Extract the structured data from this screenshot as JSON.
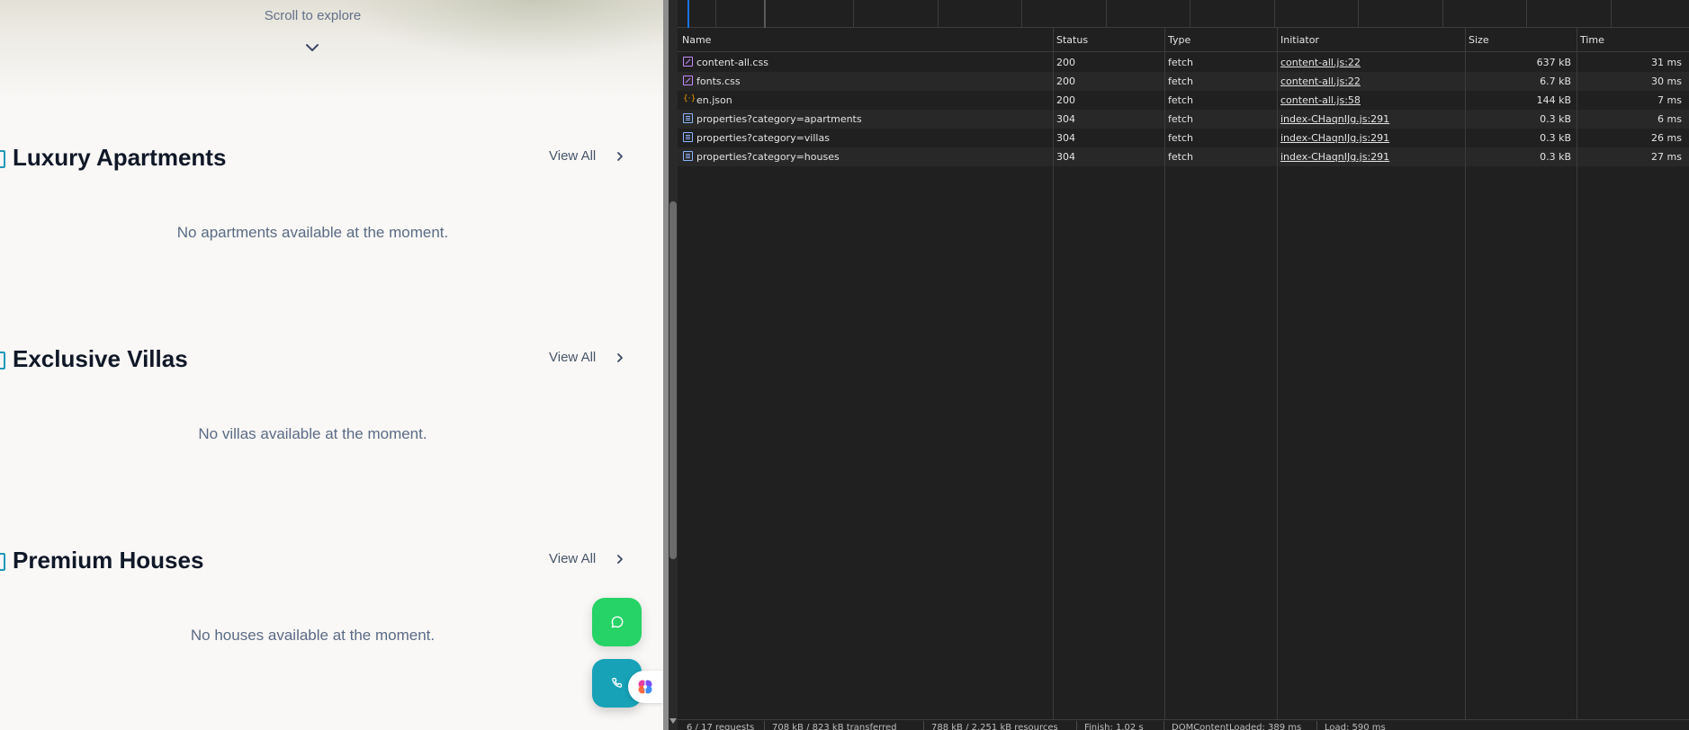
{
  "site": {
    "scroll_hint": "Scroll to explore",
    "sections": [
      {
        "title": "Luxury Apartments",
        "view_all": "View All",
        "empty": "No apartments available at the moment."
      },
      {
        "title": "Exclusive Villas",
        "view_all": "View All",
        "empty": "No villas available at the moment."
      },
      {
        "title": "Premium Houses",
        "view_all": "View All",
        "empty": "No houses available at the moment."
      }
    ],
    "fab_chat_icon": "chat-bubble-icon",
    "fab_phone_icon": "phone-icon",
    "assistant_icon": "brain-icon"
  },
  "devtools": {
    "columns": [
      "Name",
      "Status",
      "Type",
      "Initiator",
      "Size",
      "Time"
    ],
    "rows": [
      {
        "icon": "css",
        "name": "content-all.css",
        "status": "200",
        "type": "fetch",
        "initiator": "content-all.js:22",
        "size": "637 kB",
        "time": "31 ms"
      },
      {
        "icon": "css",
        "name": "fonts.css",
        "status": "200",
        "type": "fetch",
        "initiator": "content-all.js:22",
        "size": "6.7 kB",
        "time": "30 ms"
      },
      {
        "icon": "json",
        "name": "en.json",
        "status": "200",
        "type": "fetch",
        "initiator": "content-all.js:58",
        "size": "144 kB",
        "time": "7 ms"
      },
      {
        "icon": "doc",
        "name": "properties?category=apartments",
        "status": "304",
        "type": "fetch",
        "initiator": "index-CHaqnIJg.js:291",
        "size": "0.3 kB",
        "time": "6 ms"
      },
      {
        "icon": "doc",
        "name": "properties?category=villas",
        "status": "304",
        "type": "fetch",
        "initiator": "index-CHaqnIJg.js:291",
        "size": "0.3 kB",
        "time": "26 ms"
      },
      {
        "icon": "doc",
        "name": "properties?category=houses",
        "status": "304",
        "type": "fetch",
        "initiator": "index-CHaqnIJg.js:291",
        "size": "0.3 kB",
        "time": "27 ms"
      }
    ],
    "status_bar": [
      "6 / 17 requests",
      "708 kB / 823 kB transferred",
      "788 kB / 2.251 kB resources",
      "Finish: 1.02 s",
      "DOMContentLoaded: 389 ms",
      "Load: 590 ms"
    ],
    "colors": {
      "css_icon": "#c58af9",
      "json_icon": "#f29900",
      "doc_icon": "#8ab4f8",
      "timeline_marker": "#1a73e8"
    }
  }
}
